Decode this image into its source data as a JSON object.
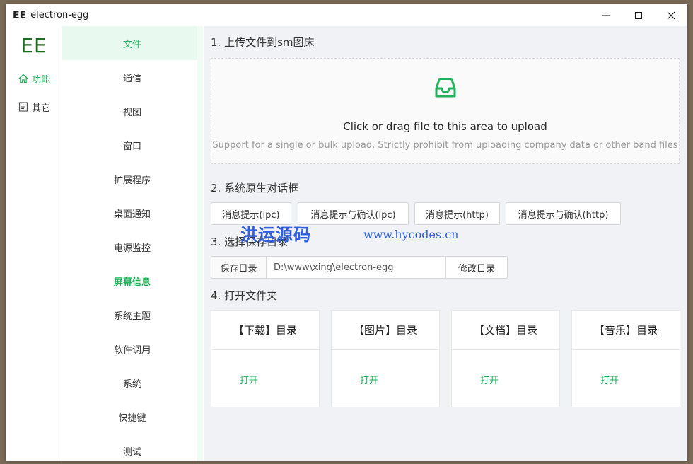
{
  "titlebar": {
    "logo": "EE",
    "title": "electron-egg"
  },
  "leftnav": {
    "brand": "EE",
    "items": [
      {
        "label": "功能",
        "icon": "home-icon"
      },
      {
        "label": "其它",
        "icon": "document-icon"
      }
    ]
  },
  "submenu": {
    "items": [
      "文件",
      "通信",
      "视图",
      "窗口",
      "扩展程序",
      "桌面通知",
      "电源监控",
      "屏幕信息",
      "系统主题",
      "软件调用",
      "系统",
      "快捷键",
      "测试"
    ]
  },
  "main": {
    "section1": {
      "title": "1. 上传文件到sm图床",
      "upload_text": "Click or drag file to this area to upload",
      "upload_hint": "Support for a single or bulk upload. Strictly prohibit from uploading company data or other band files"
    },
    "section2": {
      "title": "2. 系统原生对话框",
      "buttons": [
        "消息提示(ipc)",
        "消息提示与确认(ipc)",
        "消息提示(http)",
        "消息提示与确认(http)"
      ]
    },
    "section3": {
      "title": "3. 选择保存目录",
      "addon_label": "保存目录",
      "dir_value": "D:\\www\\xing\\electron-egg",
      "change_label": "修改目录"
    },
    "section4": {
      "title": "4. 打开文件夹",
      "cards": [
        {
          "title": "【下载】目录",
          "action": "打开"
        },
        {
          "title": "【图片】目录",
          "action": "打开"
        },
        {
          "title": "【文档】目录",
          "action": "打开"
        },
        {
          "title": "【音乐】目录",
          "action": "打开"
        }
      ]
    }
  },
  "watermark": {
    "text": "洪运源码",
    "url": "www.hycodes.cn"
  },
  "colors": {
    "accent": "#21b15b",
    "brand": "#1e6b21",
    "selected_bg": "#e8faef",
    "main_bg": "#f0f2f5"
  }
}
